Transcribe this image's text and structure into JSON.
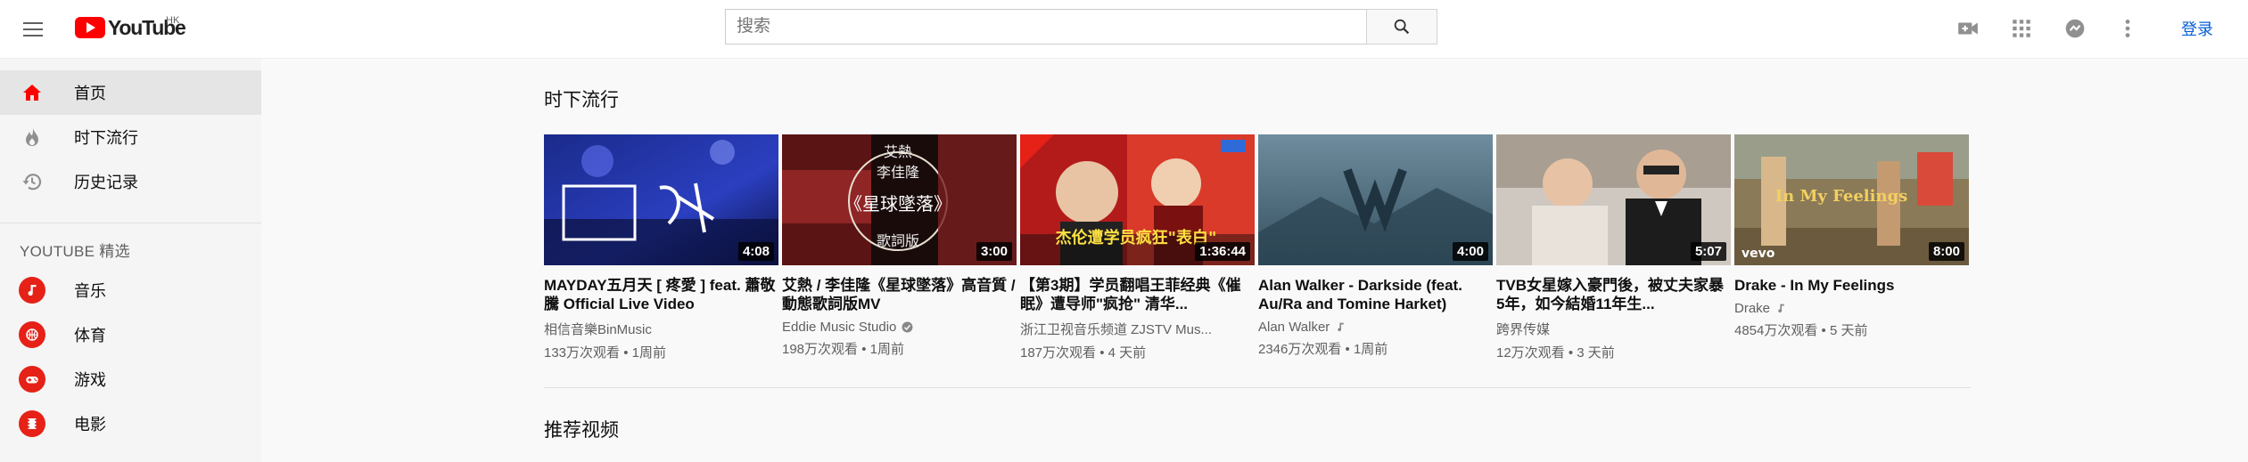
{
  "header": {
    "logo_text": "YouTube",
    "region": "HK",
    "search_placeholder": "搜索",
    "signin_label": "登录"
  },
  "sidebar": {
    "items": [
      {
        "label": "首页",
        "icon": "home-icon",
        "active": true
      },
      {
        "label": "时下流行",
        "icon": "trending-icon"
      },
      {
        "label": "历史记录",
        "icon": "history-icon"
      }
    ],
    "section_heading": "YOUTUBE 精选",
    "categories": [
      {
        "label": "音乐",
        "icon": "music-icon"
      },
      {
        "label": "体育",
        "icon": "sports-icon"
      },
      {
        "label": "游戏",
        "icon": "gaming-icon"
      },
      {
        "label": "电影",
        "icon": "movies-icon"
      }
    ]
  },
  "main": {
    "trending_title": "时下流行",
    "recommended_title": "推荐视频",
    "videos": [
      {
        "title": "MAYDAY五月天 [ 疼愛 ] feat. 蕭敬騰 Official Live Video",
        "channel": "相信音樂BinMusic",
        "meta": "133万次观看 • 1周前",
        "duration": "4:08"
      },
      {
        "title": "艾熱 / 李佳隆《星球墜落》高音質 / 動態歌詞版MV",
        "channel": "Eddie Music Studio",
        "verified": true,
        "meta": "198万次观看 • 1周前",
        "duration": "3:00"
      },
      {
        "title": "【第3期】学员翻唱王菲经典《催眠》遭导师\"疯抢\" 清华...",
        "channel": "浙江卫视音乐频道 ZJSTV Mus...",
        "meta": "187万次观看 • 4 天前",
        "duration": "1:36:44"
      },
      {
        "title": "Alan Walker - Darkside (feat. Au/Ra and Tomine Harket)",
        "channel": "Alan Walker",
        "music": true,
        "meta": "2346万次观看 • 1周前",
        "duration": "4:00"
      },
      {
        "title": "TVB女星嫁入豪門後，被丈夫家暴5年，如今結婚11年生...",
        "channel": "跨界传媒",
        "meta": "12万次观看 • 3 天前",
        "duration": "5:07"
      },
      {
        "title": "Drake - In My Feelings",
        "channel": "Drake",
        "music": true,
        "meta": "4854万次观看 • 5 天前",
        "duration": "8:00"
      }
    ]
  },
  "colors": {
    "brand_red": "#ff0000",
    "link_blue": "#065fd4",
    "category_red": "#e62117"
  }
}
